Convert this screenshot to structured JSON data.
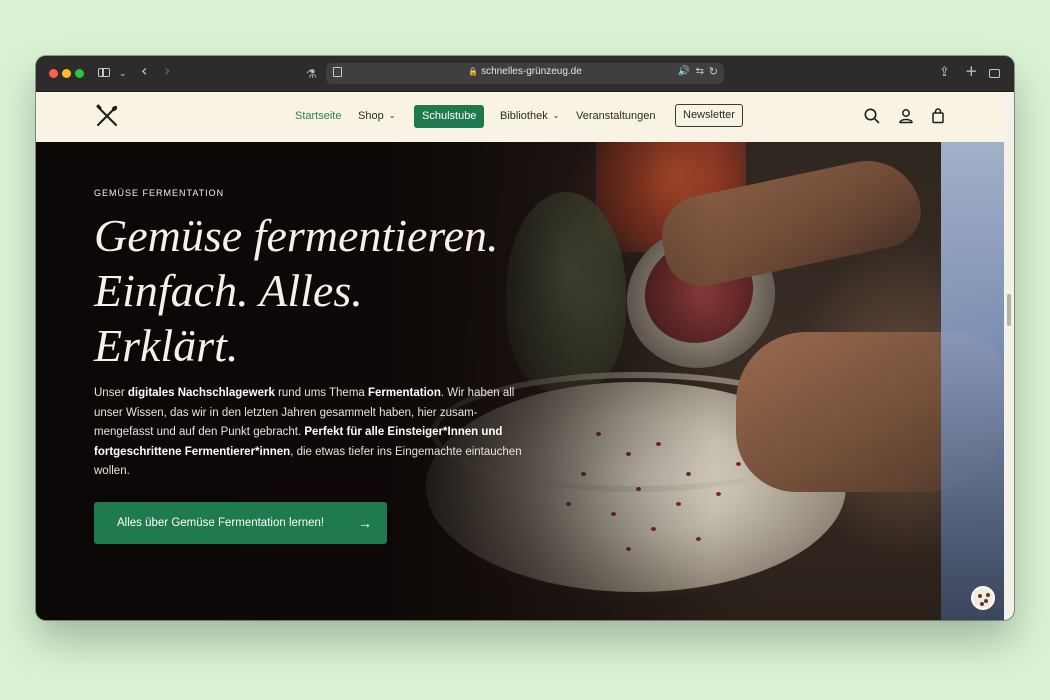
{
  "browser": {
    "url": "schnelles-grünzeug.de",
    "icons": [
      "sidebar-icon",
      "chevron-down-icon",
      "back-icon",
      "forward-icon",
      "extension-icon",
      "reader-icon",
      "lock-icon",
      "audio-icon",
      "translate-icon",
      "reload-icon",
      "share-icon",
      "new-tab-icon",
      "tab-overview-icon"
    ]
  },
  "header": {
    "nav": {
      "home": "Startseite",
      "shop": "Shop",
      "schulstube": "Schulstube",
      "bibliothek": "Bibliothek",
      "veranstaltungen": "Veranstaltungen",
      "newsletter": "Newsletter"
    },
    "icons": [
      "logo-icon",
      "search-icon",
      "account-icon",
      "cart-icon"
    ]
  },
  "hero": {
    "eyebrow": "GEMÜSE FERMENTATION",
    "title_lines": [
      "Gemüse fermentieren.",
      "Einfach. Alles.",
      "Erklärt."
    ],
    "body": {
      "p1": "Unser ",
      "b1": "digitales Nachschlagewerk",
      "p2": " rund ums Thema ",
      "b2": "Fermentation",
      "p3": ". Wir haben all unser Wissen, das wir in den letzten Jahren gesammelt haben, hier zusam-mengefasst und auf den Punkt gebracht. ",
      "b3": "Perfekt für alle Einsteiger*Innen und fortgeschrittene Fermentierer*innen",
      "p4": ", die etwas tiefer ins Eingemachte eintauchen wollen."
    },
    "cta": "Alles über Gemüse Fermentation lernen!"
  },
  "colors": {
    "accent": "#1e7a4e",
    "header_bg": "#f8f3e3",
    "page_bg": "#d9f3d3"
  }
}
